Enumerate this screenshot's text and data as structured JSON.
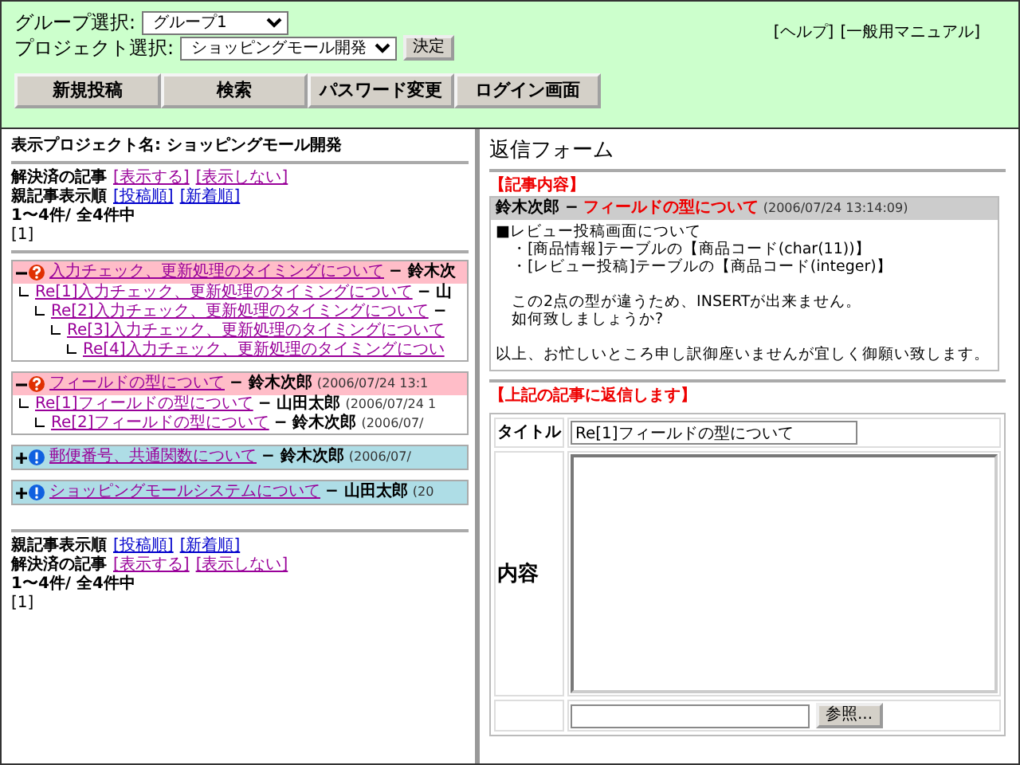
{
  "header": {
    "group_label": "グループ選択:",
    "group_value": "グループ1",
    "project_label": "プロジェクト選択:",
    "project_value": "ショッピングモール開発",
    "decide_button": "決定",
    "links": [
      "[ヘルプ]",
      "[一般用マニュアル]"
    ],
    "nav": [
      "新規投稿",
      "検索",
      "パスワード変更",
      "ログイン画面"
    ]
  },
  "sidebar": {
    "project_name": "表示プロジェクト名: ショッピングモール開発",
    "top_options": [
      {
        "label": "解決済の記事",
        "links": [
          {
            "text": "[表示する]",
            "visited": true
          },
          {
            "text": "[表示しない]",
            "visited": true
          }
        ]
      },
      {
        "label": "親記事表示順",
        "links": [
          {
            "text": "[投稿順]",
            "visited": false
          },
          {
            "text": "[新着順]",
            "visited": false
          }
        ]
      }
    ],
    "top_count": "1〜4件/ 全4件中",
    "top_pages": "[1]",
    "threads": [
      {
        "kind": "question",
        "expanded": true,
        "title": "入力チェック、更新処理のタイミングについて",
        "author": "− 鈴木次",
        "children": [
          {
            "title": "Re[1]入力チェック、更新処理のタイミングについて",
            "author": "− 山",
            "children": [
              {
                "title": "Re[2]入力チェック、更新処理のタイミングについて",
                "author": "−",
                "children": [
                  {
                    "title": "Re[3]入力チェック、更新処理のタイミングについて",
                    "children": [
                      {
                        "title": "Re[4]入力チェック、更新処理のタイミングについ"
                      }
                    ]
                  }
                ]
              }
            ]
          }
        ]
      },
      {
        "kind": "question",
        "expanded": true,
        "title": "フィールドの型について",
        "author": "− 鈴木次郎",
        "date": "(2006/07/24 13:1",
        "children": [
          {
            "title": "Re[1]フィールドの型について",
            "author": "− 山田太郎",
            "date": "(2006/07/24 1",
            "children": [
              {
                "title": "Re[2]フィールドの型について",
                "author": "− 鈴木次郎",
                "date": "(2006/07/"
              }
            ]
          }
        ]
      },
      {
        "kind": "notice",
        "expanded": false,
        "title": "郵便番号、共通関数について",
        "author": "− 鈴木次郎",
        "date": "(2006/07/"
      },
      {
        "kind": "notice",
        "expanded": false,
        "title": "ショッピングモールシステムについて",
        "author": "− 山田太郎",
        "date": "(20"
      }
    ],
    "bottom_options": [
      {
        "label": "親記事表示順",
        "links": [
          {
            "text": "[投稿順]",
            "visited": false
          },
          {
            "text": "[新着順]",
            "visited": false
          }
        ]
      },
      {
        "label": "解決済の記事",
        "links": [
          {
            "text": "[表示する]",
            "visited": true
          },
          {
            "text": "[表示しない]",
            "visited": true
          }
        ]
      }
    ],
    "bottom_count": "1〜4件/ 全4件中",
    "bottom_pages": "[1]"
  },
  "reply_form": {
    "title": "返信フォーム",
    "article_label": "【記事内容】",
    "article": {
      "author": "鈴木次郎 −",
      "title": "フィールドの型について",
      "date": "(2006/07/24 13:14:09)",
      "body": [
        [
          "■レビュー投稿画面について",
          "　・[商品情報]テーブルの【商品コード(char(11))】",
          "　・[レビュー投稿]テーブルの【商品コード(integer)】"
        ],
        [
          "　この2点の型が違うため、INSERTが出来ません。",
          "　如何致しましょうか?"
        ],
        [
          "以上、お忙しいところ申し訳御座いませんが宜しく御願い致します。"
        ]
      ]
    },
    "reply_label": "【上記の記事に返信します】",
    "title_label": "タイトル",
    "title_value": "Re[1]フィールドの型について",
    "content_label": "内容",
    "browse_button": "参照..."
  }
}
